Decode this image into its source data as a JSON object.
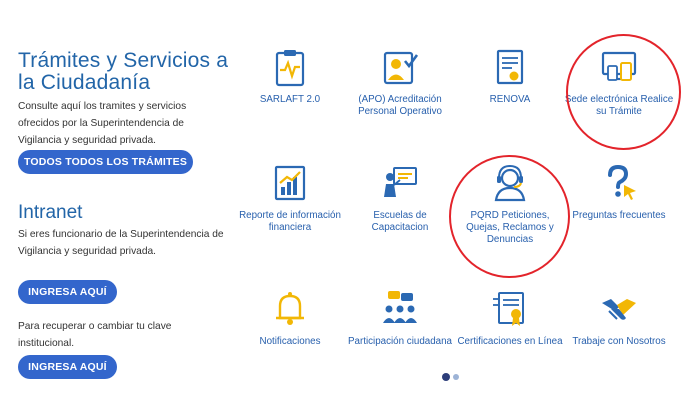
{
  "tramites": {
    "title": "Trámites y Servicios a la Ciudadanía",
    "desc": "Consulte aquí los tramites y servicios ofrecidos por la Superintendencia de Vigilancia y seguridad privada.",
    "button": "TODOS TODOS LOS TRÁMITES"
  },
  "intranet": {
    "title": "Intranet",
    "desc": "Si eres funcionario de la Superintendencia de Vigilancia y seguridad privada.",
    "button": "INGRESA AQUÍ",
    "recover_desc": "Para recuperar o cambiar tu clave institucional.",
    "recover_button": "INGRESA AQUÍ"
  },
  "services": [
    {
      "label": "SARLAFT 2.0",
      "icon": "clipboard-pulse-icon"
    },
    {
      "label": "(APO) Acreditación Personal Operativo",
      "icon": "id-card-check-icon"
    },
    {
      "label": "RENOVA",
      "icon": "document-stamp-icon"
    },
    {
      "label": "Sede electrónica Realice su Trámite",
      "icon": "devices-icon"
    },
    {
      "label": "Reporte de información financiera",
      "icon": "financial-report-icon"
    },
    {
      "label": "Escuelas de Capacitacion",
      "icon": "presentation-icon"
    },
    {
      "label": "PQRD Peticiones, Quejas, Reclamos y Denuncias",
      "icon": "headset-agent-icon"
    },
    {
      "label": "Preguntas frecuentes",
      "icon": "question-cursor-icon"
    },
    {
      "label": "Notificaciones",
      "icon": "bell-icon"
    },
    {
      "label": "Participación ciudadana",
      "icon": "people-chat-icon"
    },
    {
      "label": "Certificaciones en Línea",
      "icon": "certificate-icon"
    },
    {
      "label": "Trabaje con Nosotros",
      "icon": "handshake-icon"
    }
  ],
  "carousel": {
    "pages": 2,
    "active": 1
  },
  "colors": {
    "accent": "#3366cc",
    "heading": "#2265a8",
    "icon_blue": "#2b69b3",
    "icon_yellow": "#f2b705",
    "highlight": "#e3242b"
  }
}
